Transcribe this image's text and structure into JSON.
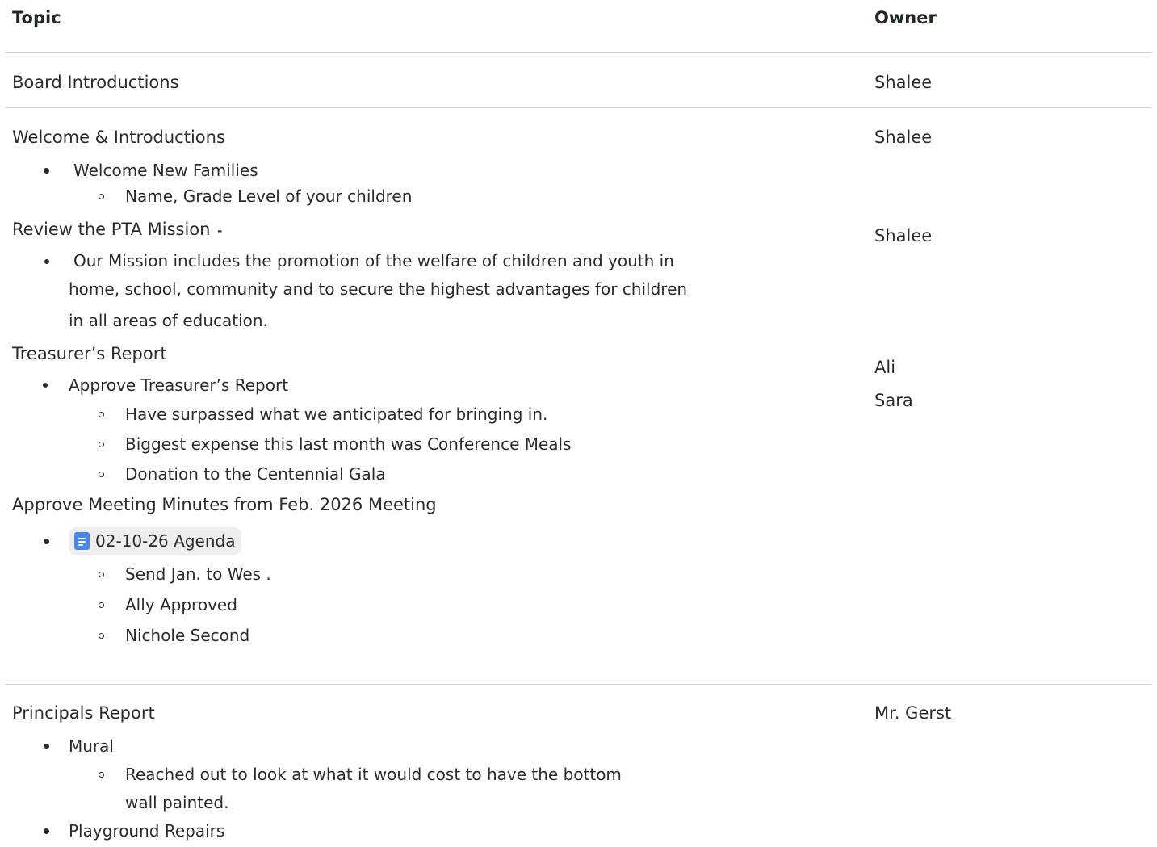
{
  "headers": {
    "topic": "Topic",
    "owner": "Owner"
  },
  "rows": {
    "board": {
      "topic": "Board Introductions",
      "owner": "Shalee"
    },
    "welcome": {
      "topic": "Welcome & Introductions",
      "owner": "Shalee",
      "bullet1": "Welcome New Families",
      "sub1": "Name, Grade Level of your children"
    },
    "mission": {
      "topic": "Review the PTA Mission",
      "topic_suffix": "-",
      "owner": "Shalee",
      "line1": "Our Mission includes the promotion of the welfare of children and youth in",
      "line2": "home, school, community and to secure the highest advantages for children",
      "line3": "in all areas of education."
    },
    "treasurer": {
      "topic": "Treasurer’s Report",
      "owner1": "Ali",
      "owner2": "Sara",
      "bullet1": "Approve Treasurer’s Report",
      "sub1": "Have surpassed what we anticipated for bringing in.",
      "sub2": "Biggest expense this last month was Conference Meals",
      "sub3": "Donation to the Centennial Gala"
    },
    "minutes": {
      "topic": "Approve Meeting Minutes from Feb. 2026 Meeting",
      "chip_label": "02-10-26 Agenda",
      "sub1": "Send Jan. to Wes .",
      "sub2": "Ally Approved",
      "sub3": "Nichole Second"
    },
    "principal": {
      "topic": "Principals Report",
      "owner": "Mr. Gerst",
      "bullet1": "Mural",
      "sub1_line1": "Reached out to look at what it would cost to have the bottom",
      "sub1_line2": "wall painted.",
      "bullet2": "Playground Repairs"
    }
  },
  "icons": {
    "doc_chip": "google-doc-icon",
    "doc_color": "#4a86f0"
  }
}
